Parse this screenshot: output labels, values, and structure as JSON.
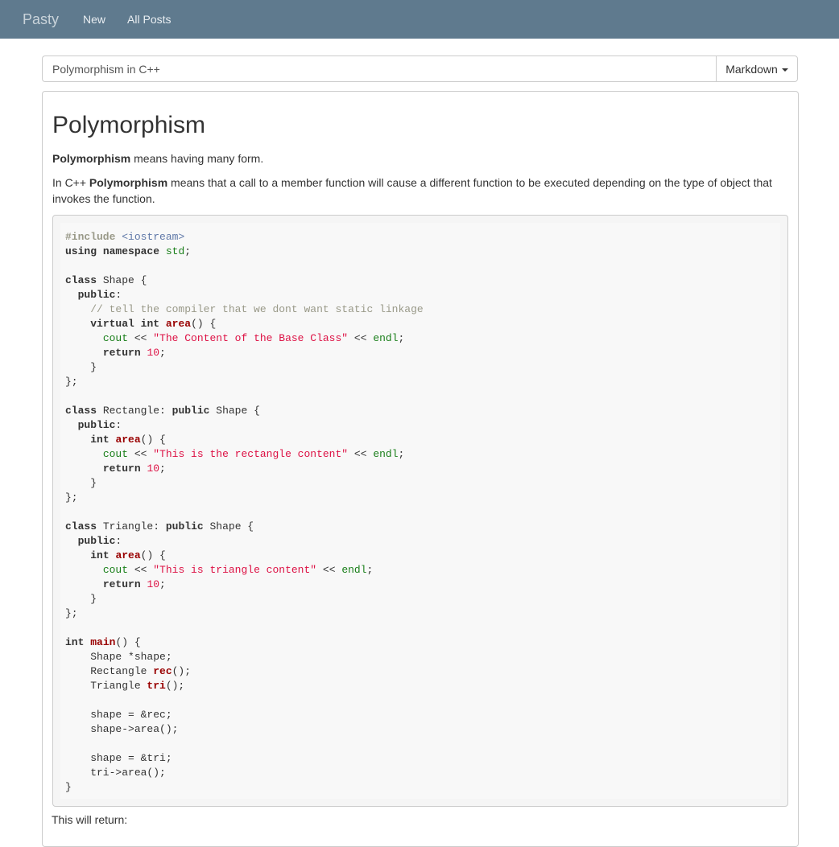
{
  "navbar": {
    "brand": "Pasty",
    "links": [
      "New",
      "All Posts"
    ]
  },
  "editor": {
    "title_value": "Polymorphism in C++",
    "mode_label": "Markdown"
  },
  "post": {
    "heading": "Polymorphism",
    "p1_bold": "Polymorphism",
    "p1_rest": " means having many form.",
    "p2_pre": "In C++ ",
    "p2_bold": "Polymorphism",
    "p2_rest": " means that a call to a member function will cause a different function to be executed depending on the type of object that invokes the function.",
    "after_code": "This will return:"
  },
  "code": {
    "include_kw": "#include",
    "include_file": "<iostream>",
    "using": "using",
    "namespace": "namespace",
    "std": "std",
    "class": "class",
    "public": "public",
    "virtual": "virtual",
    "int": "int",
    "return": "return",
    "cout": "cout",
    "endl": "endl",
    "ten": "10",
    "area": "area",
    "main": "main",
    "rec": "rec",
    "tri": "tri",
    "shape_name": "Shape",
    "rect_name": "Rectangle",
    "tri_name": "Triangle",
    "comment": "// tell the compiler that we dont want static linkage",
    "str_base": "\"The Content of the Base Class\"",
    "str_rect": "\"This is the rectangle content\"",
    "str_tri": "\"This is triangle content\"",
    "l_shape_ptr": "    Shape *shape;",
    "l_rect_decl": "    Rectangle ",
    "l_tri_decl": "    Triangle ",
    "l_assign_rec": "    shape = &rec;",
    "l_call_area": "    shape->area();",
    "l_assign_tri": "    shape = &tri;",
    "l_tri_call": "    tri->area();"
  }
}
